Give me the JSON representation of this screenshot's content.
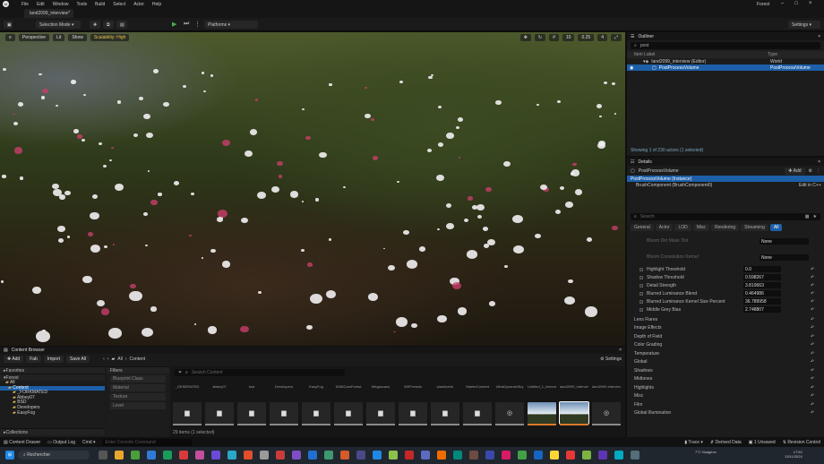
{
  "menubar": {
    "items": [
      "File",
      "Edit",
      "Window",
      "Tools",
      "Build",
      "Select",
      "Actor",
      "Help"
    ],
    "project": "Forest"
  },
  "tab": {
    "label": "land2099_interview*"
  },
  "toolbar": {
    "selection_mode": "Selection Mode",
    "platforms": "Platforms",
    "settings": "Settings"
  },
  "viewport": {
    "perspective": "Perspective",
    "lit": "Lit",
    "show": "Show",
    "scalability": "Scalability: High",
    "snap_angle": "10",
    "snap_scale": "0.25",
    "camera_speed": "4"
  },
  "outliner": {
    "title": "Outliner",
    "search": "post",
    "col_label": "Item Label",
    "col_type": "Type",
    "rows": [
      {
        "label": "land2099_interview (Editor)",
        "type": "World"
      },
      {
        "label": "PostProcessVolume",
        "type": "PostProcessVolume"
      }
    ],
    "status": "Showing 1 of 230 actors (1 selected)"
  },
  "details": {
    "title": "Details",
    "actor": "PostProcessVolume",
    "add": "Add",
    "instance": "PostProcessVolume (Instance)",
    "brush": "BrushComponent (BrushComponent0)",
    "edit_cpp": "Edit in C++",
    "search": "Search",
    "tabs": [
      "General",
      "Actor",
      "LOD",
      "Misc",
      "Rendering",
      "Streaming",
      "All"
    ],
    "lens_rows": [
      {
        "label": "Bloom Dirt Mask Tint",
        "value": "None"
      },
      {
        "label": "Bloom Convolution Kernel",
        "value": "None"
      }
    ],
    "props": [
      {
        "label": "Highlight Threshold",
        "value": "0.0"
      },
      {
        "label": "Shadow Threshold",
        "value": "0.598267"
      },
      {
        "label": "Detail Strength",
        "value": "3.819663"
      },
      {
        "label": "Blurred Luminance Blend",
        "value": "0.464986"
      },
      {
        "label": "Blurred Luminance Kernel Size Percent",
        "value": "36.789958"
      },
      {
        "label": "Middle Grey Bias",
        "value": "2.748807"
      }
    ],
    "sections": [
      "Lens Flares",
      "Image Effects",
      "Depth of Field",
      "Color Grading",
      "Temperature",
      "Global",
      "Shadows",
      "Midtones",
      "Highlights",
      "Misc",
      "Film",
      "Global Illumination"
    ]
  },
  "content_browser": {
    "title": "Content Browser",
    "add": "Add",
    "fab": "Fab",
    "import": "Import",
    "save_all": "Save All",
    "path": [
      "All",
      "Content"
    ],
    "settings": "Settings",
    "favorites": "Favorites",
    "forest": "Forest",
    "collections": "Collections",
    "tree": [
      "All",
      "Content",
      "_FORKMATED",
      "Abbey07",
      "BSD",
      "Developers",
      "EasyFog"
    ],
    "filters_title": "Filters",
    "filters": [
      "Blueprint Class",
      "Material",
      "Texture",
      "Level"
    ],
    "search": "Search Content",
    "assets": [
      {
        "label": "_GENERATED",
        "icon": "▆"
      },
      {
        "label": "abbey07",
        "icon": "▆"
      },
      {
        "label": "bsd",
        "icon": "▆"
      },
      {
        "label": "Developers",
        "icon": "▆"
      },
      {
        "label": "EasyFog",
        "icon": "▆"
      },
      {
        "label": "KMDCamForest",
        "icon": "▆"
      },
      {
        "label": "Megascans",
        "icon": "▆"
      },
      {
        "label": "MSPresets",
        "icon": "▆"
      },
      {
        "label": "planktorrie",
        "icon": "▆"
      },
      {
        "label": "StarterContent",
        "icon": "▆"
      },
      {
        "label": "UltraDynamicSky",
        "icon": "◎"
      },
      {
        "label": "Untitled_1_interview",
        "icon": "▭"
      },
      {
        "label": "land2099_interview",
        "icon": "▭"
      },
      {
        "label": "land2099 interview",
        "icon": "◎"
      }
    ],
    "count": "29 items (1 selected)"
  },
  "statusbar": {
    "content_drawer": "Content Drawer",
    "output_log": "Output Log",
    "cmd": "Cmd",
    "console": "Enter Console Command",
    "derived_data": "Derived Data",
    "unsaved": "1 Unsaved",
    "revision": "Revision Control"
  },
  "taskbar": {
    "search": "Rechercher",
    "weather": "7°C Nuageux",
    "time": "17:52",
    "date": "13/11/2024"
  }
}
